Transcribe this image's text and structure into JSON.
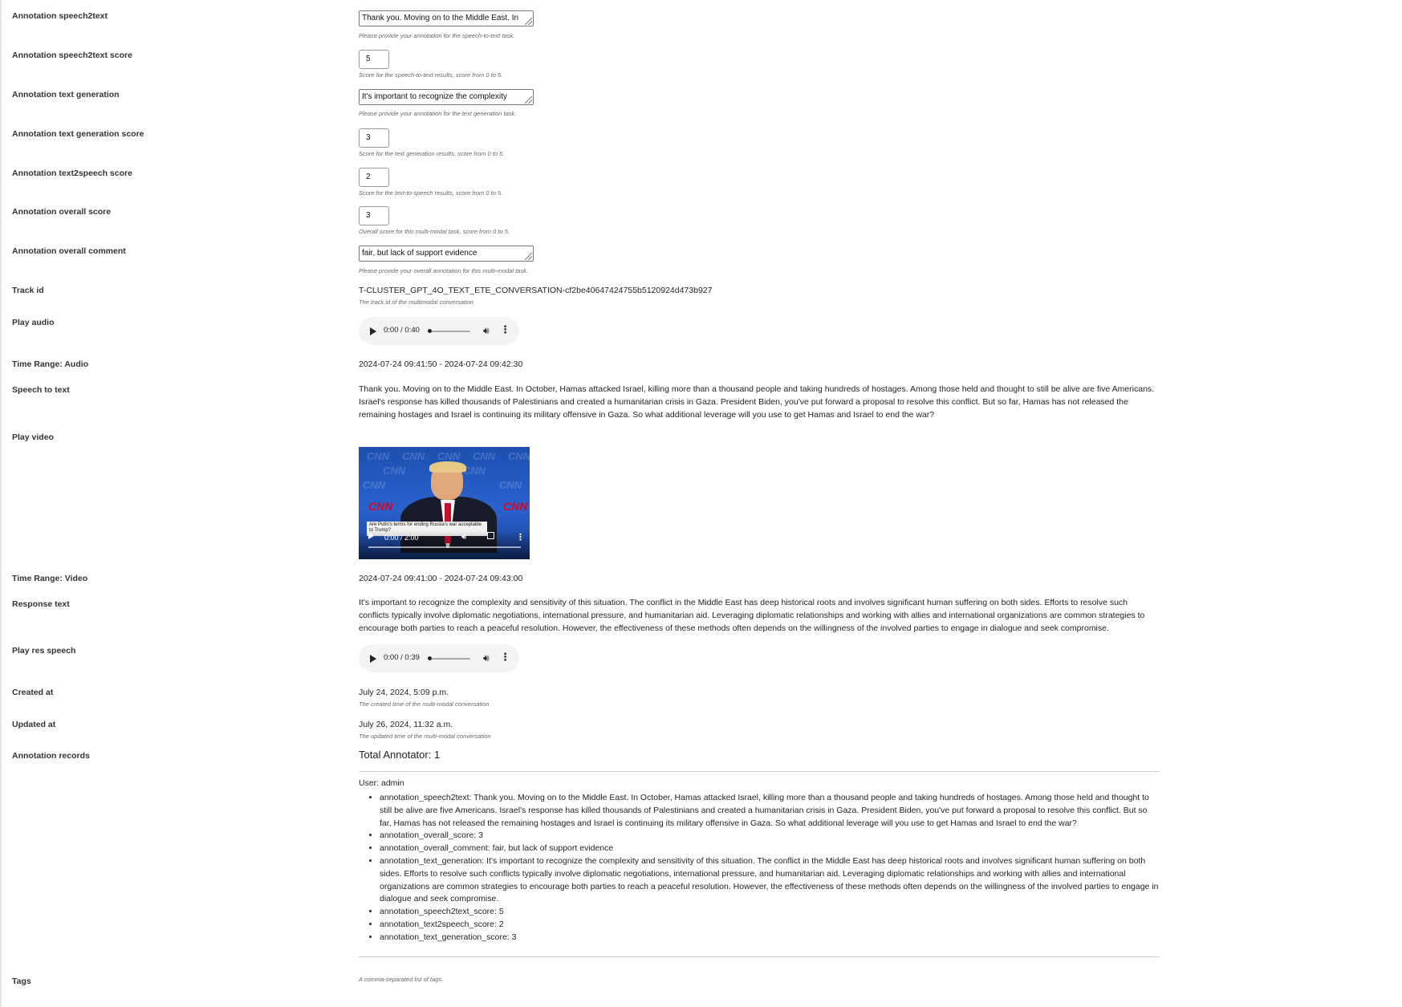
{
  "fields": {
    "speech2text": {
      "label": "Annotation speech2text",
      "value": "Thank you. Moving on to the Middle East. In",
      "help": "Please provide your annotation for the speech-to-text task."
    },
    "speech2text_score": {
      "label": "Annotation speech2text score",
      "value": "5",
      "help": "Score for the speech-to-text results, score from 0 to 5."
    },
    "text_generation": {
      "label": "Annotation text generation",
      "value": "It's important to recognize the complexity",
      "help": "Please provide your annotation for the text generation task."
    },
    "text_generation_score": {
      "label": "Annotation text generation score",
      "value": "3",
      "help": "Score for the text generation results, score from 0 to 5."
    },
    "text2speech_score": {
      "label": "Annotation text2speech score",
      "value": "2",
      "help": "Score for the text-to-speech results, score from 0 to 5."
    },
    "overall_score": {
      "label": "Annotation overall score",
      "value": "3",
      "help": "Overall score for this multi-modal task, score from 0 to 5."
    },
    "overall_comment": {
      "label": "Annotation overall comment",
      "value": "fair, but lack of support evidence",
      "help": "Please provide your overall annotation for this multi-modal task."
    }
  },
  "track": {
    "label": "Track id",
    "value": "T-CLUSTER_GPT_4O_TEXT_ETE_CONVERSATION-cf2be40647424755b5120924d473b927",
    "help": "The track id of the multimodal conversation"
  },
  "play_audio": {
    "label": "Play audio",
    "time": "0:00 / 0:40",
    "progress": 0
  },
  "time_range_audio": {
    "label": "Time Range: Audio",
    "value": "2024-07-24 09:41:50 - 2024-07-24 09:42:30"
  },
  "speech_to_text": {
    "label": "Speech to text",
    "value": "Thank you. Moving on to the Middle East. In October, Hamas attacked Israel, killing more than a thousand people and taking hundreds of hostages. Among those held and thought to still be alive are five Americans. Israel's response has killed thousands of Palestinians and created a humanitarian crisis in Gaza. President Biden, you've put forward a proposal to resolve this conflict. But so far, Hamas has not released the remaining hostages and Israel is continuing its military offensive in Gaza. So what additional leverage will you use to get Hamas and Israel to end the war?"
  },
  "play_video": {
    "label": "Play video",
    "time": "0:00 / 2:00",
    "brand": "CNN",
    "chyron": "Are Putin's terms for ending Russia's war acceptable to Trump?"
  },
  "time_range_video": {
    "label": "Time Range: Video",
    "value": "2024-07-24 09:41:00 - 2024-07-24 09:43:00"
  },
  "response_text": {
    "label": "Response text",
    "value": "It's important to recognize the complexity and sensitivity of this situation. The conflict in the Middle East has deep historical roots and involves significant human suffering on both sides. Efforts to resolve such conflicts typically involve diplomatic negotiations, international pressure, and humanitarian aid. Leveraging diplomatic relationships and working with allies and international organizations are common strategies to encourage both parties to reach a peaceful resolution. However, the effectiveness of these methods often depends on the willingness of the involved parties to engage in dialogue and seek compromise."
  },
  "play_res_speech": {
    "label": "Play res speech",
    "time": "0:00 / 0:39",
    "progress": 0
  },
  "created_at": {
    "label": "Created at",
    "value": "July 24, 2024, 5:09 p.m.",
    "help": "The created time of the multi-modal conversation"
  },
  "updated_at": {
    "label": "Updated at",
    "value": "July 26, 2024, 11:32 a.m.",
    "help": "The updated time of the multi-modal conversation"
  },
  "annotation_records": {
    "label": "Annotation records",
    "total": "Total Annotator: 1",
    "user": "User: admin",
    "items": [
      "annotation_speech2text: Thank you. Moving on to the Middle East. In October, Hamas attacked Israel, killing more than a thousand people and taking hundreds of hostages. Among those held and thought to still be alive are five Americans. Israel's response has killed thousands of Palestinians and created a humanitarian crisis in Gaza. President Biden, you've put forward a proposal to resolve this conflict. But so far, Hamas has not released the remaining hostages and Israel is continuing its military offensive in Gaza. So what additional leverage will you use to get Hamas and Israel to end the war?",
      "annotation_overall_score: 3",
      "annotation_overall_comment: fair, but lack of support evidence",
      "annotation_text_generation: It's important to recognize the complexity and sensitivity of this situation. The conflict in the Middle East has deep historical roots and involves significant human suffering on both sides. Efforts to resolve such conflicts typically involve diplomatic negotiations, international pressure, and humanitarian aid. Leveraging diplomatic relationships and working with allies and international organizations are common strategies to encourage both parties to reach a peaceful resolution. However, the effectiveness of these methods often depends on the willingness of the involved parties to engage in dialogue and seek compromise.",
      "annotation_speech2text_score: 5",
      "annotation_text2speech_score: 2",
      "annotation_text_generation_score: 3"
    ]
  },
  "tags": {
    "label": "Tags",
    "help": "A comma-separated list of tags."
  }
}
